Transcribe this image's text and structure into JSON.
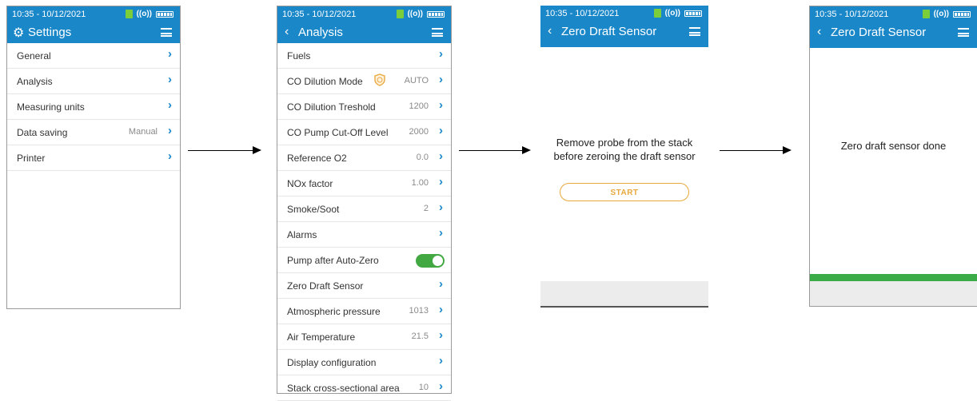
{
  "statusbar": {
    "time": "10:35 - 10/12/2021",
    "radio_glyph": "((o))"
  },
  "icons": {
    "sd_card": "sd-card-icon",
    "radio": "radio-signal-icon",
    "battery": "battery-icon",
    "menu": "hamburger-menu-icon",
    "back": "chevron-left-icon",
    "gear": "gear-icon",
    "row": "chevron-right-icon",
    "shield": "shield-icon"
  },
  "colors": {
    "header": "#1a87c9",
    "chevron": "#1a87c9",
    "toggle_on": "#42a842",
    "start_button": "#e8a83b",
    "progress": "#3aab47"
  },
  "screen1": {
    "title": "Settings",
    "items": [
      {
        "label": "General",
        "value": ""
      },
      {
        "label": "Analysis",
        "value": ""
      },
      {
        "label": "Measuring units",
        "value": ""
      },
      {
        "label": "Data saving",
        "value": "Manual"
      },
      {
        "label": "Printer",
        "value": ""
      }
    ]
  },
  "screen2": {
    "title": "Analysis",
    "items": [
      {
        "label": "Fuels",
        "value": ""
      },
      {
        "label": "CO Dilution Mode",
        "value": "AUTO"
      },
      {
        "label": "CO Dilution Treshold",
        "value": "1200"
      },
      {
        "label": "CO Pump Cut-Off Level",
        "value": "2000"
      },
      {
        "label": "Reference O2",
        "value": "0.0"
      },
      {
        "label": "NOx factor",
        "value": "1.00"
      },
      {
        "label": "Smoke/Soot",
        "value": "2"
      },
      {
        "label": "Alarms",
        "value": ""
      },
      {
        "label": "Pump after Auto-Zero",
        "value": ""
      },
      {
        "label": "Zero Draft Sensor",
        "value": ""
      },
      {
        "label": "Atmospheric pressure",
        "value": "1013"
      },
      {
        "label": "Air Temperature",
        "value": "21.5"
      },
      {
        "label": "Display configuration",
        "value": ""
      },
      {
        "label": "Stack cross-sectional area",
        "value": "10"
      }
    ],
    "pump_after_autozero_on": true
  },
  "screen3": {
    "title": "Zero Draft Sensor",
    "message_line1": "Remove probe from the stack",
    "message_line2": "before zeroing the draft sensor",
    "start_label": "START"
  },
  "screen4": {
    "title": "Zero Draft Sensor",
    "message": "Zero draft sensor done",
    "progress": 1.0
  }
}
